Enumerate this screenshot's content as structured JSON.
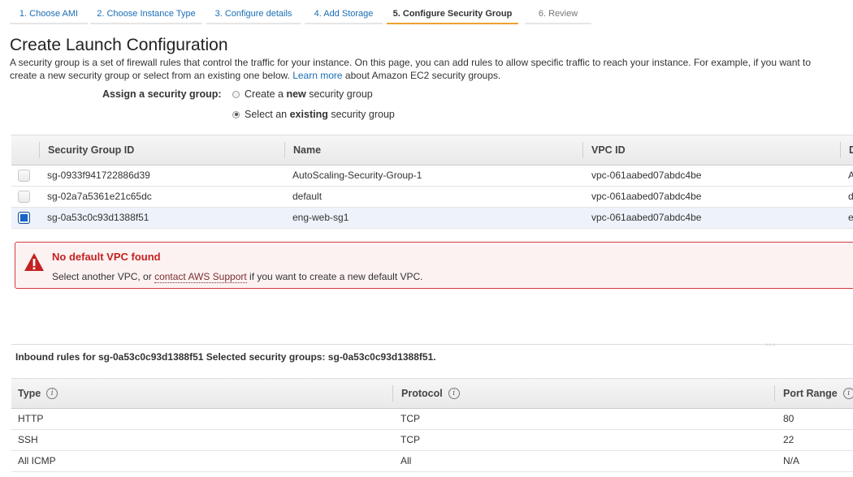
{
  "wizard": {
    "steps": [
      {
        "label": "1. Choose AMI",
        "state": "link"
      },
      {
        "label": "2. Choose Instance Type",
        "state": "link"
      },
      {
        "label": "3. Configure details",
        "state": "link"
      },
      {
        "label": "4. Add Storage",
        "state": "link"
      },
      {
        "label": "5. Configure Security Group",
        "state": "active"
      },
      {
        "label": "6. Review",
        "state": "disabled"
      }
    ]
  },
  "page": {
    "title": "Create Launch Configuration",
    "intro_part1": "A security group is a set of firewall rules that control the traffic for your instance. On this page, you can add rules to allow specific traffic to reach your instance. For example, if you want to",
    "intro_part2": "create a new security group or select from an existing one below.",
    "learn_more": "Learn more",
    "intro_part3": "about Amazon EC2 security groups."
  },
  "assign": {
    "label": "Assign a security group:",
    "option_new_prefix": "Create a",
    "option_new_bold": "new",
    "option_new_suffix": "security group",
    "option_existing_prefix": "Select an",
    "option_existing_bold": "existing",
    "option_existing_suffix": "security group",
    "selected": "existing"
  },
  "sg_table": {
    "headers": [
      "Security Group ID",
      "Name",
      "VPC ID",
      "D"
    ],
    "rows": [
      {
        "id": "sg-0933f941722886d39",
        "name": "AutoScaling-Security-Group-1",
        "vpc": "vpc-061aabed07abdc4be",
        "desc": "A",
        "checked": false
      },
      {
        "id": "sg-02a7a5361e21c65dc",
        "name": "default",
        "vpc": "vpc-061aabed07abdc4be",
        "desc": "d",
        "checked": false
      },
      {
        "id": "sg-0a53c0c93d1388f51",
        "name": "eng-web-sg1",
        "vpc": "vpc-061aabed07abdc4be",
        "desc": "e",
        "checked": true
      }
    ]
  },
  "alert": {
    "title": "No default VPC found",
    "text_prefix": "Select another VPC, or",
    "link": "contact AWS Support",
    "text_suffix": "if you want to create a new default VPC.",
    "color": "#d13b3b"
  },
  "inbound": {
    "caption": "Inbound rules for sg-0a53c0c93d1388f51 Selected security groups: sg-0a53c0c93d1388f51.",
    "headers": [
      "Type",
      "Protocol",
      "Port Range"
    ],
    "rows": [
      {
        "type": "HTTP",
        "protocol": "TCP",
        "port": "80"
      },
      {
        "type": "SSH",
        "protocol": "TCP",
        "port": "22"
      },
      {
        "type": "All ICMP",
        "protocol": "All",
        "port": "N/A"
      }
    ]
  },
  "colors": {
    "link": "#1a6eb4",
    "active_step": "#f0a030",
    "selected_checkbox": "#1a63c6"
  }
}
